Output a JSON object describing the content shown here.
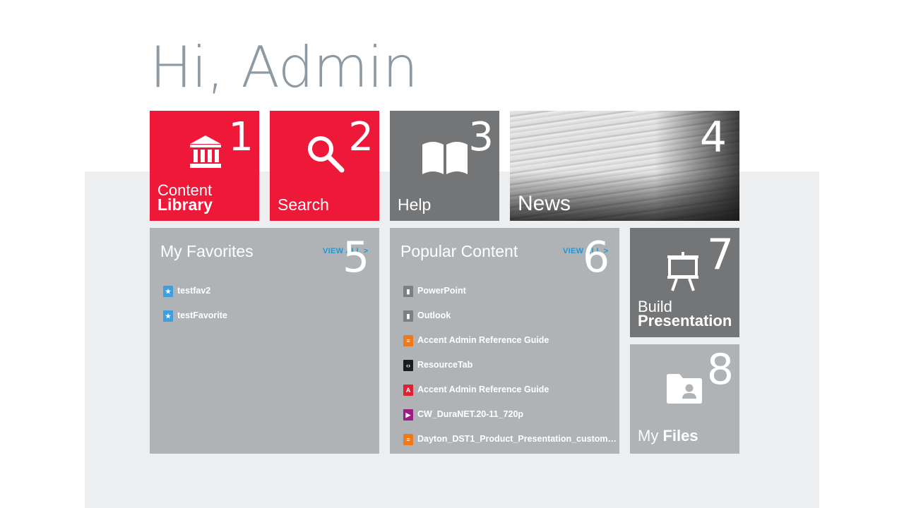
{
  "greeting": "Hi, Admin",
  "tiles": {
    "content_library": {
      "num": "1",
      "line1": "Content",
      "line2": "Library",
      "icon": "bank-icon"
    },
    "search": {
      "num": "2",
      "label": "Search",
      "icon": "search-icon"
    },
    "help": {
      "num": "3",
      "label": "Help",
      "icon": "book-icon"
    },
    "news": {
      "num": "4",
      "label": "News"
    },
    "build_presentation": {
      "num": "7",
      "line1": "Build",
      "line2": "Presentation",
      "icon": "easel-icon"
    },
    "my_files": {
      "num": "8",
      "line1": "My",
      "line2": "Files",
      "icon": "folder-user-icon"
    }
  },
  "favorites": {
    "num": "5",
    "title": "My Favorites",
    "view_all": "VIEW ALL >",
    "items": [
      {
        "label": "testfav2",
        "icon": "favorite-file-icon"
      },
      {
        "label": "testFavorite",
        "icon": "favorite-file-icon"
      }
    ]
  },
  "popular": {
    "num": "6",
    "title": "Popular Content",
    "view_all": "VIEW ALL >",
    "items": [
      {
        "label": "PowerPoint",
        "icon": "powerpoint-file-icon"
      },
      {
        "label": "Outlook",
        "icon": "outlook-file-icon"
      },
      {
        "label": "Accent Admin Reference Guide",
        "icon": "document-file-icon"
      },
      {
        "label": "ResourceTab",
        "icon": "code-file-icon"
      },
      {
        "label": "Accent Admin Reference Guide",
        "icon": "pdf-file-icon"
      },
      {
        "label": "CW_DuraNET.20-11_720p",
        "icon": "video-file-icon"
      },
      {
        "label": "Dayton_DST1_Product_Presentation_custom…",
        "icon": "document-file-icon"
      }
    ]
  },
  "colors": {
    "tile_red": "#ee1838",
    "tile_dark_gray": "#737577",
    "tile_light_gray": "#b0b3b6",
    "view_all_blue": "#1f97d8"
  }
}
